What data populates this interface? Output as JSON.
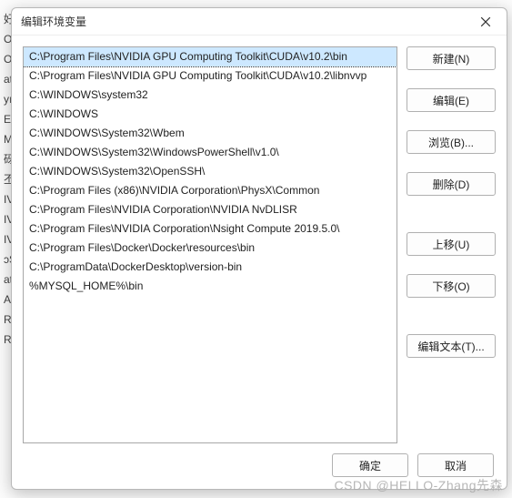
{
  "background_fragments": [
    "好,",
    "",
    "On",
    "On",
    "",
    "at",
    "yı",
    "EN",
    "M",
    "",
    "",
    "",
    "",
    "",
    "",
    "砑",
    "",
    "丕",
    "IV",
    "IV",
    "IV",
    "ɔS",
    "at",
    "A",
    "R",
    "R"
  ],
  "dialog": {
    "title": "编辑环境变量",
    "close_icon": "close"
  },
  "paths": [
    "C:\\Program Files\\NVIDIA GPU Computing Toolkit\\CUDA\\v10.2\\bin",
    "C:\\Program Files\\NVIDIA GPU Computing Toolkit\\CUDA\\v10.2\\libnvvp",
    "C:\\WINDOWS\\system32",
    "C:\\WINDOWS",
    "C:\\WINDOWS\\System32\\Wbem",
    "C:\\WINDOWS\\System32\\WindowsPowerShell\\v1.0\\",
    "C:\\WINDOWS\\System32\\OpenSSH\\",
    "C:\\Program Files (x86)\\NVIDIA Corporation\\PhysX\\Common",
    "C:\\Program Files\\NVIDIA Corporation\\NVIDIA NvDLISR",
    "C:\\Program Files\\NVIDIA Corporation\\Nsight Compute 2019.5.0\\",
    "C:\\Program Files\\Docker\\Docker\\resources\\bin",
    "C:\\ProgramData\\DockerDesktop\\version-bin",
    "%MYSQL_HOME%\\bin"
  ],
  "selected_index": 0,
  "buttons": {
    "new": "新建(N)",
    "edit": "编辑(E)",
    "browse": "浏览(B)...",
    "delete": "删除(D)",
    "moveup": "上移(U)",
    "movedown": "下移(O)",
    "edittext": "编辑文本(T)...",
    "ok": "确定",
    "cancel": "取消"
  },
  "watermark": "CSDN @HELLO-Zhang先森"
}
